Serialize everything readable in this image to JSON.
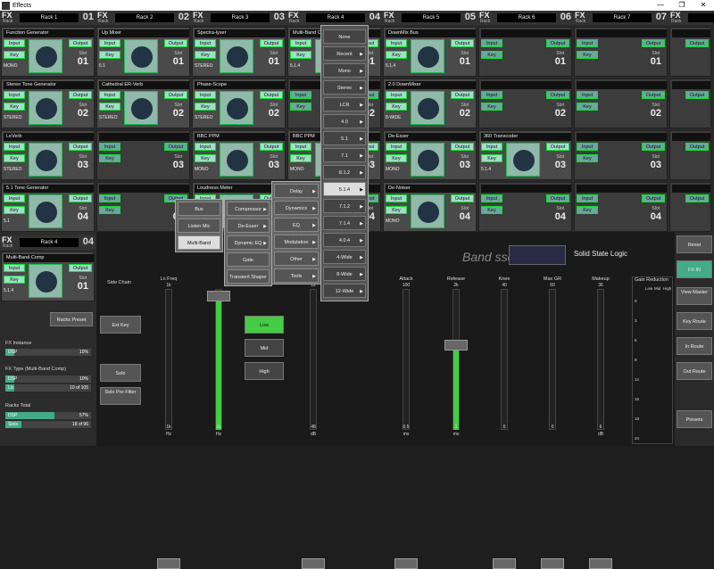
{
  "window": {
    "title": "Effects",
    "min": "—",
    "max": "❐",
    "close": "✕"
  },
  "racks": [
    {
      "fx": "FX",
      "sub": "Rack",
      "name": "Rack 1",
      "num": "01",
      "slots": [
        {
          "name": "Function Generator",
          "input": "Input",
          "output": "Output",
          "key": "Key",
          "format": "MONO",
          "slot_label": "Slot",
          "slot_num": "01",
          "filled": true
        },
        {
          "name": "Stereo Tone Generator",
          "input": "Input",
          "output": "Output",
          "key": "Key",
          "format": "STEREO",
          "slot_label": "Slot",
          "slot_num": "02",
          "filled": true
        },
        {
          "name": "LeVerb",
          "input": "Input",
          "output": "Output",
          "key": "Key",
          "format": "STEREO",
          "slot_label": "Slot",
          "slot_num": "03",
          "filled": true
        },
        {
          "name": "5.1 Tone Generator",
          "input": "Input",
          "output": "Output",
          "key": "Key",
          "format": "5.1",
          "slot_label": "Slot",
          "slot_num": "04",
          "filled": true
        }
      ]
    },
    {
      "fx": "FX",
      "sub": "Rack",
      "name": "Rack 2",
      "num": "02",
      "slots": [
        {
          "name": "Up Mixer",
          "input": "Input",
          "output": "Output",
          "key": "Key",
          "format": "5.1",
          "slot_label": "Slot",
          "slot_num": "01",
          "filled": true
        },
        {
          "name": "Cathedral ER-Verb",
          "input": "Input",
          "output": "Output",
          "key": "Key",
          "format": "STEREO",
          "slot_label": "Slot",
          "slot_num": "02",
          "filled": true
        },
        {
          "name": "",
          "input": "Input",
          "output": "Output",
          "key": "Key",
          "format": "",
          "slot_label": "Slot",
          "slot_num": "03",
          "filled": false
        },
        {
          "name": "",
          "input": "Input",
          "output": "Output",
          "key": "Key",
          "format": "",
          "slot_label": "Slot",
          "slot_num": "04",
          "filled": false
        }
      ]
    },
    {
      "fx": "FX",
      "sub": "Rack",
      "name": "Rack 3",
      "num": "03",
      "slots": [
        {
          "name": "Spectra-lyser",
          "input": "Input",
          "output": "Output",
          "key": "Key",
          "format": "STEREO",
          "slot_label": "Slot",
          "slot_num": "01",
          "filled": true
        },
        {
          "name": "Phase-Scope",
          "input": "Input",
          "output": "Output",
          "key": "Key",
          "format": "STEREO",
          "slot_label": "Slot",
          "slot_num": "02",
          "filled": true
        },
        {
          "name": "BBC PPM",
          "input": "Input",
          "output": "Output",
          "key": "Key",
          "format": "MONO",
          "slot_label": "Slot",
          "slot_num": "03",
          "filled": true
        },
        {
          "name": "Loudness Meter",
          "input": "Input",
          "output": "Output",
          "key": "Key",
          "format": "",
          "slot_label": "Slot",
          "slot_num": "04",
          "filled": true
        }
      ]
    },
    {
      "fx": "FX",
      "sub": "Rack",
      "name": "Rack 4",
      "num": "04",
      "slots": [
        {
          "name": "Multi-Band C",
          "input": "Input",
          "output": "Output",
          "key": "Key",
          "format": "5.1.4",
          "slot_label": "Slot",
          "slot_num": "01",
          "filled": true
        },
        {
          "name": "",
          "input": "Input",
          "output": "Output",
          "key": "Key",
          "format": "",
          "slot_label": "Slot",
          "slot_num": "02",
          "filled": false
        },
        {
          "name": "BBC PPM",
          "input": "Input",
          "output": "Output",
          "key": "Key",
          "format": "MONO",
          "slot_label": "Slot",
          "slot_num": "03",
          "filled": true
        },
        {
          "name": "",
          "input": "Input",
          "output": "Output",
          "key": "Key",
          "format": "",
          "slot_label": "Slot",
          "slot_num": "04",
          "filled": false
        }
      ]
    },
    {
      "fx": "FX",
      "sub": "Rack",
      "name": "Rack 5",
      "num": "05",
      "slots": [
        {
          "name": "DownMix Bus",
          "input": "Input",
          "output": "Output",
          "key": "Key",
          "format": "5.1.4",
          "slot_label": "Slot",
          "slot_num": "01",
          "filled": true
        },
        {
          "name": "2.0 DownMixer",
          "input": "Input",
          "output": "Output",
          "key": "Key",
          "format": "8-WIDE",
          "slot_label": "Slot",
          "slot_num": "02",
          "filled": true
        },
        {
          "name": "De-Esser",
          "input": "Input",
          "output": "Output",
          "key": "Key",
          "format": "MONO",
          "slot_label": "Slot",
          "slot_num": "03",
          "filled": true
        },
        {
          "name": "De-Noiser",
          "input": "Input",
          "output": "Output",
          "key": "Key",
          "format": "MONO",
          "slot_label": "Slot",
          "slot_num": "04",
          "filled": true
        }
      ]
    },
    {
      "fx": "FX",
      "sub": "Rack",
      "name": "Rack 6",
      "num": "06",
      "slots": [
        {
          "name": "",
          "input": "Input",
          "output": "Output",
          "key": "Key",
          "format": "",
          "slot_label": "Slot",
          "slot_num": "01",
          "filled": false
        },
        {
          "name": "",
          "input": "Input",
          "output": "Output",
          "key": "Key",
          "format": "",
          "slot_label": "Slot",
          "slot_num": "02",
          "filled": false
        },
        {
          "name": "360 Transcoder",
          "input": "Input",
          "output": "Output",
          "key": "Key",
          "format": "5.1.4",
          "slot_label": "Slot",
          "slot_num": "03",
          "filled": true
        },
        {
          "name": "",
          "input": "Input",
          "output": "Output",
          "key": "Key",
          "format": "",
          "slot_label": "Slot",
          "slot_num": "04",
          "filled": false
        }
      ]
    },
    {
      "fx": "FX",
      "sub": "Rack",
      "name": "Rack 7",
      "num": "07",
      "slots": [
        {
          "name": "",
          "input": "Input",
          "output": "Output",
          "key": "Key",
          "format": "",
          "slot_label": "Slot",
          "slot_num": "01",
          "filled": false
        },
        {
          "name": "",
          "input": "Input",
          "output": "Output",
          "key": "Key",
          "format": "",
          "slot_label": "Slot",
          "slot_num": "02",
          "filled": false
        },
        {
          "name": "",
          "input": "Input",
          "output": "Output",
          "key": "Key",
          "format": "",
          "slot_label": "Slot",
          "slot_num": "03",
          "filled": false
        },
        {
          "name": "",
          "input": "Input",
          "output": "Output",
          "key": "Key",
          "format": "",
          "slot_label": "Slot",
          "slot_num": "04",
          "filled": false
        }
      ]
    },
    {
      "fx": "FX",
      "sub": "Rack",
      "name": "",
      "num": "",
      "slots": [
        {
          "name": "",
          "input": "",
          "output": "Output",
          "key": "",
          "format": "",
          "slot_label": "",
          "slot_num": "",
          "filled": false
        },
        {
          "name": "",
          "input": "",
          "output": "Output",
          "key": "",
          "format": "",
          "slot_label": "",
          "slot_num": "",
          "filled": false
        },
        {
          "name": "",
          "input": "",
          "output": "Output",
          "key": "",
          "format": "",
          "slot_label": "",
          "slot_num": "",
          "filled": false
        },
        {
          "name": "",
          "input": "",
          "output": "Output",
          "key": "",
          "format": "",
          "slot_label": "",
          "slot_num": "",
          "filled": false
        }
      ]
    }
  ],
  "left_panel": {
    "fx": "FX",
    "sub": "Rack",
    "rack_name": "Rack 4",
    "rack_num": "04",
    "slot": {
      "name": "Multi-Band Comp",
      "input": "Input",
      "output": "Output",
      "key": "Key",
      "format": "5.1.4",
      "slot_label": "Slot",
      "slot_num": "01"
    },
    "racks_preset": "Racks Preset",
    "fx_instance": "FX Instance",
    "dsp_label": "DSP",
    "dsp_instance_pct": "10%",
    "fx_type": "FX Type  (Multi-Band Comp)",
    "type_dsp_pct": "10%",
    "type_lic": "Lic",
    "type_lic_val": "10 of 105",
    "racks_total": "Racks Total",
    "total_dsp_pct": "57%",
    "total_slots_label": "Slots",
    "total_slots_val": "18 of 96",
    "meters": {
      "instance": 0.1,
      "type": 0.1,
      "total": 0.57,
      "slots": 0.19
    }
  },
  "plugin": {
    "title": "Band ssor",
    "brand": "Solid State Logic",
    "side_chain": "Side Chain",
    "ext_key": "Ext Key",
    "solo": "Solo",
    "solo_prefilter": "Solo Pre-Filter",
    "bands": [
      "Low",
      "Mid",
      "High"
    ],
    "faders": [
      {
        "label": "Lo Freq",
        "top": "1k",
        "bottom": "1k",
        "unit": "Hz",
        "level": 0.0
      },
      {
        "label": "",
        "top": "",
        "bottom": "1k",
        "unit": "Hz",
        "level": 0.95
      },
      {
        "label": "",
        "top": "12",
        "bottom": "48",
        "unit": "dB",
        "level": 0.0
      },
      {
        "label": "Attack",
        "top": "100",
        "bottom": "0.5",
        "unit": "ms",
        "level": 0.0
      },
      {
        "label": "Release",
        "top": "2k",
        "bottom": "1",
        "unit": "ms",
        "level": 0.6
      },
      {
        "label": "Knee",
        "top": "40",
        "bottom": "0",
        "unit": "",
        "level": 0.0
      },
      {
        "label": "Max GR",
        "top": "60",
        "bottom": "0",
        "unit": "",
        "level": 0.0
      },
      {
        "label": "Makeup",
        "top": "36",
        "bottom": "6",
        "unit": "dB",
        "level": 0.0
      }
    ],
    "gain_reduction": "Gain Reduction",
    "gr_cols": [
      "Low",
      "Mid",
      "High"
    ],
    "gr_scale": [
      "0",
      "3",
      "6",
      "9",
      "12",
      "15",
      "18",
      "24"
    ]
  },
  "right_panel": {
    "reset": "Reset",
    "fx_in": "FX IN",
    "view_master": "View Master",
    "key_route": "Key Route",
    "in_route": "In Route",
    "out_route": "Out Route",
    "presets": "Presets"
  },
  "dropdown": {
    "items": [
      "None",
      "Recent",
      "Mono",
      "Stereo",
      "LCR",
      "4.0",
      "5.1",
      "7.1",
      "8.1.2",
      "5.1.4",
      "7.1.2",
      "7.1.4",
      "4.0.4",
      "4-Wide",
      "8-Wide",
      "12-Wide"
    ],
    "has_arrow": [
      false,
      true,
      true,
      true,
      true,
      true,
      true,
      true,
      true,
      true,
      true,
      true,
      true,
      true,
      true,
      true
    ]
  },
  "submenu_cat": {
    "items": [
      "Delay",
      "Dynamics",
      "EQ",
      "Modulation",
      "Other",
      "Tools"
    ]
  },
  "submenu_dyn": {
    "items": [
      "Compressor",
      "De-Esser",
      "Dynamic EQ",
      "Gate",
      "Transient Shaper"
    ]
  },
  "submenu_comp": {
    "items": [
      "Bus",
      "Listen Mic",
      "Multi-Band"
    ]
  }
}
